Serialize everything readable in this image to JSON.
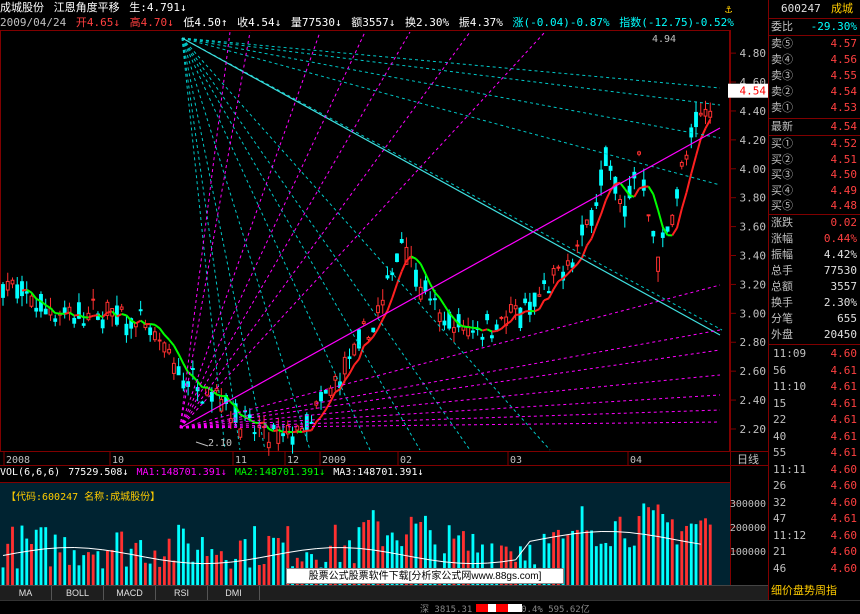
{
  "header": {
    "stock_name": "成城股份",
    "indicator": "江恩角度平移",
    "param": "生:4.791↓",
    "date": "2009/04/24",
    "open": "开4.65↓",
    "high": "高4.70↓",
    "low": "低4.50↑",
    "close": "收4.54↓",
    "volume": "量77530↓",
    "amount": "额3557↓",
    "turnover": "换2.30%",
    "amplitude": "振4.37%",
    "change": "涨(-0.04)-0.87%",
    "index": "指数(-12.75)-0.52%"
  },
  "anchor_icon": "anchor-icon",
  "price_axis": {
    "labels": [
      "4.80",
      "4.60",
      "4.40",
      "4.20",
      "4.00",
      "3.80",
      "3.60",
      "3.40",
      "3.20",
      "3.00",
      "2.80",
      "2.60",
      "2.40",
      "2.20"
    ],
    "current": "4.54",
    "top_high": "4.94",
    "low_label": "2.10"
  },
  "time_axis": [
    "2008",
    "10",
    "11",
    "12",
    "2009",
    "02",
    "03",
    "04"
  ],
  "period_label": "日线",
  "volume_header": {
    "name": "VOL(6,6,6)",
    "v": "77529.508↓",
    "ma1": "MA1:148701.391↓",
    "ma2": "MA2:148701.391↓",
    "ma3": "MA3:148701.391↓"
  },
  "volume_subtitle": "【代码:600247 名称:成城股份】",
  "volume_axis": [
    "300000",
    "200000",
    "100000"
  ],
  "banner": "股票公式股票软件下载[分析家公式网www.88gs.com]",
  "tabs": [
    "MA",
    "BOLL",
    "MACD",
    "RSI",
    "DMI"
  ],
  "side": {
    "code": "600247",
    "name": "成城",
    "weibi_label": "委比",
    "weibi": "-29.30%",
    "sell": [
      {
        "label": "卖⑤",
        "price": "4.57"
      },
      {
        "label": "卖④",
        "price": "4.56"
      },
      {
        "label": "卖③",
        "price": "4.55"
      },
      {
        "label": "卖②",
        "price": "4.54"
      },
      {
        "label": "卖①",
        "price": "4.53"
      }
    ],
    "latest_label": "最新",
    "latest": "4.54",
    "buy": [
      {
        "label": "买①",
        "price": "4.52"
      },
      {
        "label": "买②",
        "price": "4.51"
      },
      {
        "label": "买③",
        "price": "4.50"
      },
      {
        "label": "买④",
        "price": "4.49"
      },
      {
        "label": "买⑤",
        "price": "4.48"
      }
    ],
    "stats": [
      {
        "label": "涨跌",
        "value": "0.02",
        "color": "#ff4040"
      },
      {
        "label": "涨幅",
        "value": "0.44%",
        "color": "#ff4040"
      },
      {
        "label": "振幅",
        "value": "4.42%",
        "color": "#e0e0e0"
      },
      {
        "label": "总手",
        "value": "77530",
        "color": "#e0e0e0"
      },
      {
        "label": "总额",
        "value": "3557",
        "color": "#e0e0e0"
      },
      {
        "label": "换手",
        "value": "2.30%",
        "color": "#e0e0e0"
      },
      {
        "label": "分笔",
        "value": "655",
        "color": "#e0e0e0"
      },
      {
        "label": "外盘",
        "value": "20450",
        "color": "#e0e0e0"
      }
    ],
    "ticks": [
      {
        "time": "11:09",
        "price": "4.60"
      },
      {
        "time": "56",
        "price": "4.61"
      },
      {
        "time": "11:10",
        "price": "4.61"
      },
      {
        "time": "15",
        "price": "4.61"
      },
      {
        "time": "22",
        "price": "4.61"
      },
      {
        "time": "40",
        "price": "4.61"
      },
      {
        "time": "55",
        "price": "4.61"
      },
      {
        "time": "11:11",
        "price": "4.60"
      },
      {
        "time": "26",
        "price": "4.60"
      },
      {
        "time": "32",
        "price": "4.60"
      },
      {
        "time": "47",
        "price": "4.61"
      },
      {
        "time": "11:12",
        "price": "4.60"
      },
      {
        "time": "21",
        "price": "4.60"
      },
      {
        "time": "46",
        "price": "4.60"
      }
    ],
    "footer_tabs": "细价盘势周指"
  },
  "status_text": "深 3815.31 -15.24 -0.4% 595.62亿",
  "colors": {
    "up": "#ff3030",
    "down": "#00ffff",
    "ma_green": "#00ff00",
    "magenta": "#ff00ff",
    "axis": "#800000"
  }
}
